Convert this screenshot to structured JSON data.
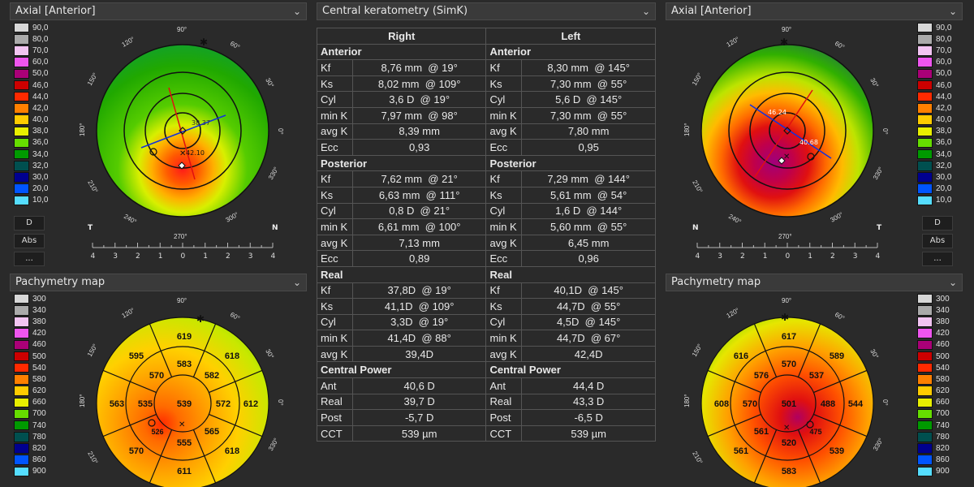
{
  "panels": {
    "top_left_title": "Axial [Anterior]",
    "center_title": "Central keratometry (SimK)",
    "top_right_title": "Axial [Anterior]",
    "bottom_left_title": "Pachymetry map",
    "bottom_right_title": "Pachymetry map",
    "chevron": "⌄"
  },
  "axial_legend": [
    "90,0",
    "80,0",
    "70,0",
    "60,0",
    "50,0",
    "46,0",
    "44,0",
    "42,0",
    "40,0",
    "38,0",
    "36,0",
    "34,0",
    "32,0",
    "30,0",
    "20,0",
    "10,0"
  ],
  "pachy_legend": [
    "300",
    "340",
    "380",
    "420",
    "460",
    "500",
    "540",
    "580",
    "620",
    "660",
    "700",
    "740",
    "780",
    "820",
    "860",
    "900"
  ],
  "legend_colors": [
    "#d7d7d7",
    "#aaaaaa",
    "#f2c4f2",
    "#ee55ee",
    "#aa0077",
    "#cc0000",
    "#ff2a00",
    "#ff8000",
    "#ffcc00",
    "#e8f000",
    "#66dd00",
    "#009a00",
    "#004f4f",
    "#00008f",
    "#0055ff",
    "#55ddff"
  ],
  "buttons": {
    "d": "D",
    "abs": "Abs",
    "more": "..."
  },
  "axes": {
    "deg90": "90°",
    "deg60": "60°",
    "deg30": "30°",
    "deg0": "0°",
    "deg330": "330°",
    "deg300": "300°",
    "deg270": "270°",
    "deg240": "240°",
    "deg210": "210°",
    "deg180": "180°",
    "deg150": "150°",
    "deg120": "120°",
    "scale": [
      "4",
      "3",
      "2",
      "1",
      "0",
      "1",
      "2",
      "3",
      "4"
    ]
  },
  "left_corner": {
    "t": "T",
    "n": "N"
  },
  "right_corner": {
    "n": "N",
    "t": "T"
  },
  "left_axial": {
    "val1": "38.37",
    "val2": "42.10"
  },
  "right_axial": {
    "val1": "46.24",
    "val2": "40.68"
  },
  "left_pachy": {
    "center": "539",
    "inner": [
      "583",
      "582",
      "572",
      "555",
      "535",
      "570"
    ],
    "inner_pos": [
      "583",
      "582",
      "572",
      "565",
      "555",
      "535",
      "570"
    ],
    "outer": [
      "619",
      "618",
      "612",
      "618",
      "611",
      "570",
      "563",
      "595"
    ],
    "min": "526"
  },
  "right_pachy": {
    "center": "501",
    "inner": [
      "570",
      "537",
      "488",
      "520",
      "570",
      "576"
    ],
    "inner_extra": [
      "561"
    ],
    "outer": [
      "617",
      "589",
      "544",
      "539",
      "583",
      "561",
      "608",
      "616"
    ],
    "min": "475"
  },
  "keratometry": {
    "col_right": "Right",
    "col_left": "Left",
    "sections": [
      {
        "title": "Anterior",
        "rows": [
          [
            "Kf",
            "8,76 mm  @ 19°",
            "Kf",
            "8,30 mm  @ 145°"
          ],
          [
            "Ks",
            "8,02 mm  @ 109°",
            "Ks",
            "7,30 mm  @ 55°"
          ],
          [
            "Cyl",
            "3,6 D  @ 19°",
            "Cyl",
            "5,6 D  @ 145°"
          ],
          [
            "min K",
            "7,97 mm  @ 98°",
            "min K",
            "7,30 mm  @ 55°"
          ],
          [
            "avg K",
            "8,39 mm",
            "avg K",
            "7,80 mm"
          ],
          [
            "Ecc",
            "0,93",
            "Ecc",
            "0,95"
          ]
        ]
      },
      {
        "title": "Posterior",
        "rows": [
          [
            "Kf",
            "7,62 mm  @ 21°",
            "Kf",
            "7,29 mm  @ 144°"
          ],
          [
            "Ks",
            "6,63 mm  @ 111°",
            "Ks",
            "5,61 mm  @ 54°"
          ],
          [
            "Cyl",
            "0,8 D  @ 21°",
            "Cyl",
            "1,6 D  @ 144°"
          ],
          [
            "min K",
            "6,61 mm  @ 100°",
            "min K",
            "5,60 mm  @ 55°"
          ],
          [
            "avg K",
            "7,13 mm",
            "avg K",
            "6,45 mm"
          ],
          [
            "Ecc",
            "0,89",
            "Ecc",
            "0,96"
          ]
        ]
      },
      {
        "title": "Real",
        "rows": [
          [
            "Kf",
            "37,8D  @ 19°",
            "Kf",
            "40,1D  @ 145°"
          ],
          [
            "Ks",
            "41,1D  @ 109°",
            "Ks",
            "44,7D  @ 55°"
          ],
          [
            "Cyl",
            "3,3D  @ 19°",
            "Cyl",
            "4,5D  @ 145°"
          ],
          [
            "min K",
            "41,4D  @ 88°",
            "min K",
            "44,7D  @ 67°"
          ],
          [
            "avg K",
            "39,4D",
            "avg K",
            "42,4D"
          ]
        ]
      },
      {
        "title": "Central Power",
        "rows": [
          [
            "Ant",
            "40,6 D",
            "Ant",
            "44,4 D"
          ],
          [
            "Real",
            "39,7 D",
            "Real",
            "43,3 D"
          ],
          [
            "Post",
            "-5,7 D",
            "Post",
            "-6,5 D"
          ],
          [
            "CCT",
            "539 µm",
            "CCT",
            "539 µm"
          ]
        ]
      }
    ]
  }
}
